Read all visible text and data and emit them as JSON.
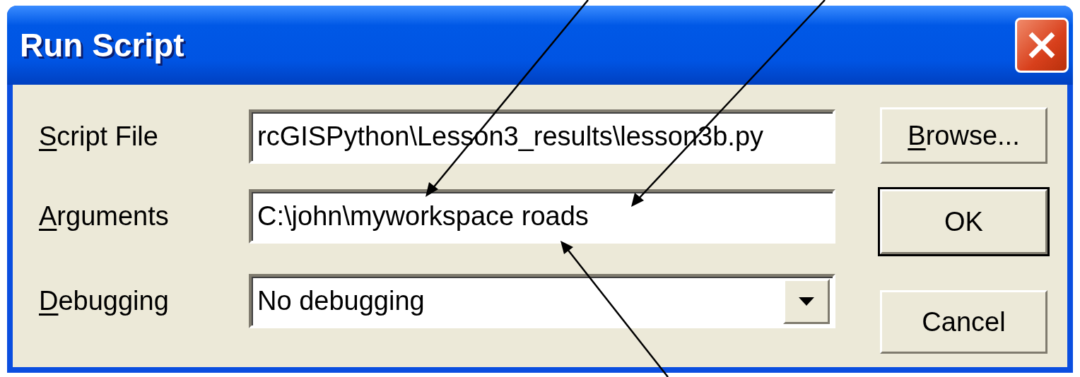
{
  "window": {
    "title": "Run Script"
  },
  "fields": [
    {
      "kind": "text",
      "label": "Script File",
      "underline_first": true,
      "value": "rcGISPython\\Lesson3_results\\lesson3b.py"
    },
    {
      "kind": "text",
      "label": "Arguments",
      "underline_first": true,
      "value": "C:\\john\\myworkspace roads"
    },
    {
      "kind": "dropdown",
      "label": "Debugging",
      "underline_first": true,
      "value": "No debugging"
    }
  ],
  "buttons": [
    {
      "label": "Browse...",
      "underline_first": true,
      "default": false
    },
    {
      "label": "OK",
      "underline_first": false,
      "default": true
    },
    {
      "label": "Cancel",
      "underline_first": false,
      "default": false
    }
  ]
}
